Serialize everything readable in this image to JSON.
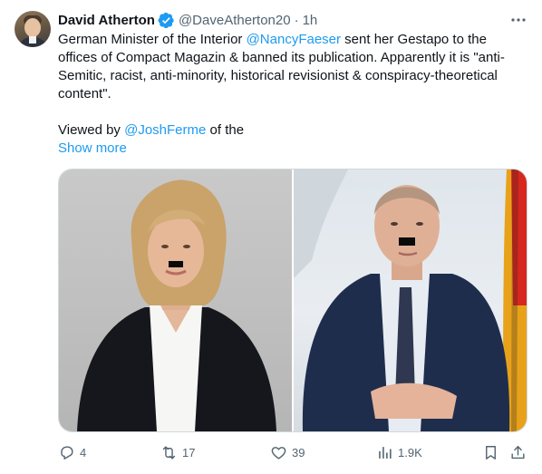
{
  "tweet": {
    "author": "David Atherton",
    "handle": "@DaveAtherton20",
    "separator": "·",
    "time": "1h",
    "text": {
      "p1_a": "German Minister of the Interior ",
      "p1_mention": "@NancyFaeser",
      "p1_b1": " sent her Gestapo to the",
      "p1_b2": "offices of Compact Magazin & banned its publication. Apparently it is \"anti-",
      "p1_b3": "Semitic, racist, anti-minority, historical revisionist  & conspiracy-theoretical",
      "p1_b4": "content\".",
      "p2_a": "Viewed by ",
      "p2_mention": "@JoshFerme",
      "p2_b": " of the"
    },
    "show_more": "Show more",
    "stats": {
      "replies": "4",
      "reposts": "17",
      "likes": "39",
      "views": "1.9K"
    }
  },
  "colors": {
    "accent": "#1d9bf0",
    "secondary_text": "#536471",
    "primary_text": "#0f1419",
    "border": "#cfd9de"
  },
  "icons": {
    "more": "more-dots-icon",
    "verified": "verified-badge-icon",
    "reply": "reply-icon",
    "repost": "repost-icon",
    "like": "heart-icon",
    "views": "views-chart-icon",
    "bookmark": "bookmark-icon",
    "share": "share-icon"
  }
}
